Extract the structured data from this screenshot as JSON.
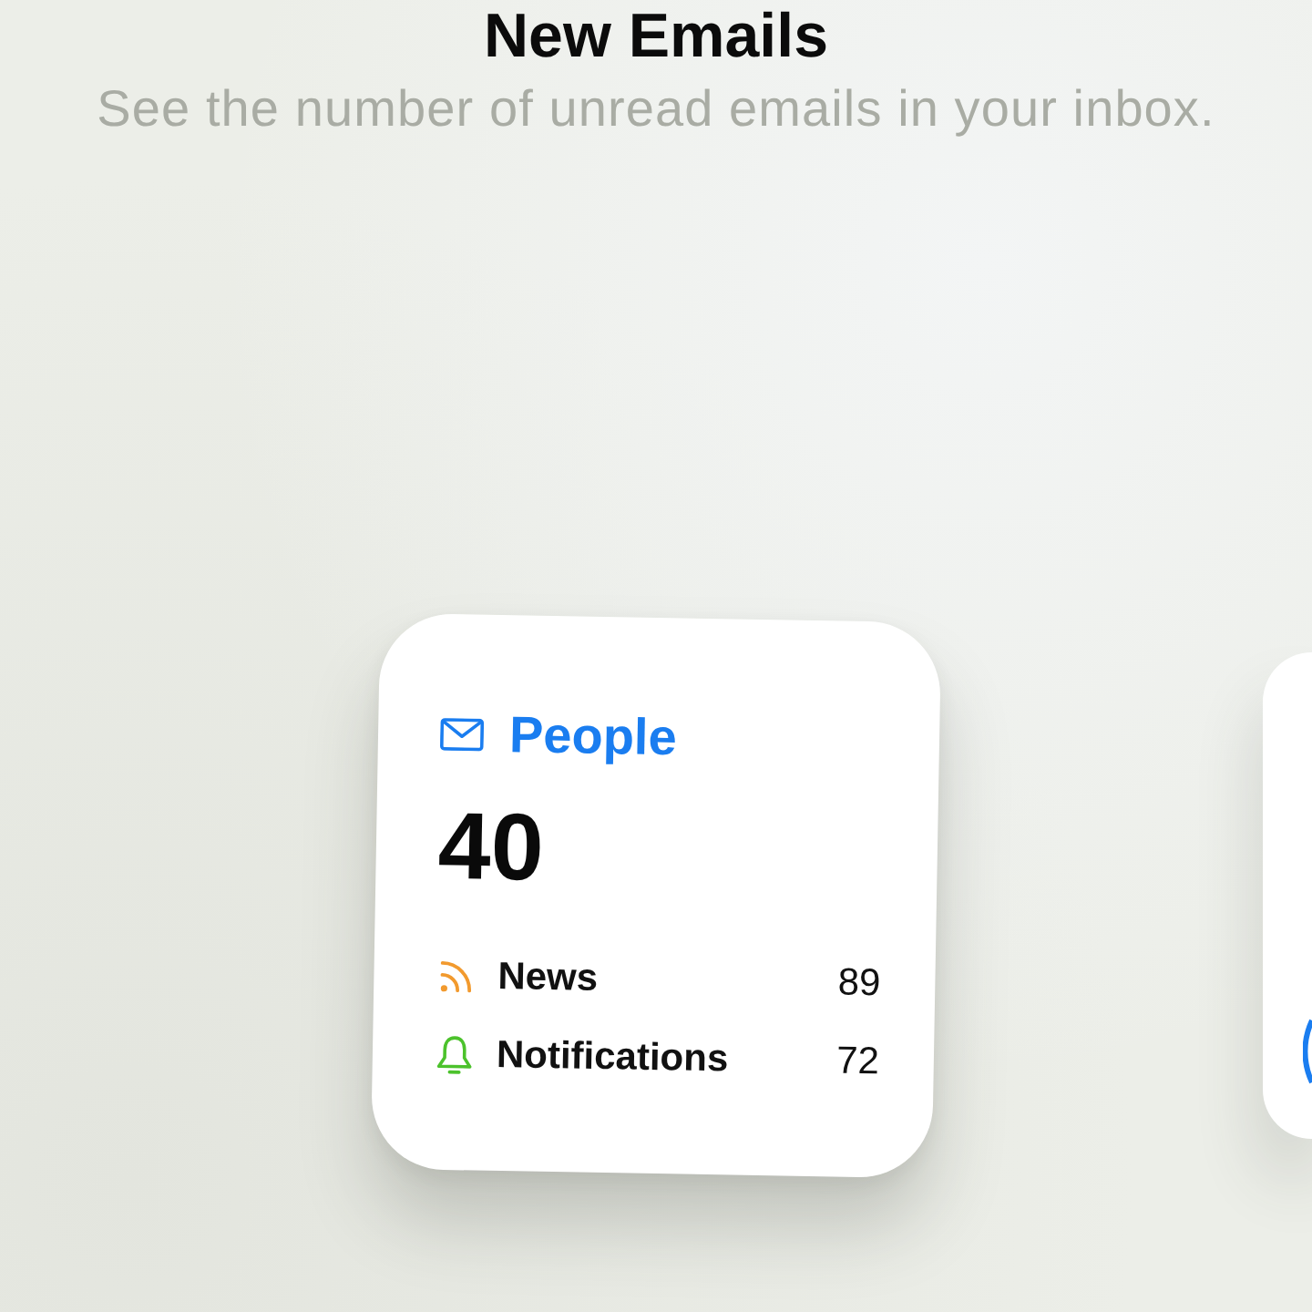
{
  "header": {
    "title": "New Emails",
    "subtitle": "See the number of unread emails in your inbox."
  },
  "widgets": [
    {
      "kind": "mail",
      "title": "People",
      "count": "40",
      "rows": [
        {
          "kind": "feed",
          "label": "News",
          "count": "89",
          "color": "#f29a2e"
        },
        {
          "kind": "alert",
          "label": "Notifications",
          "count": "72",
          "color": "#4cc22c"
        }
      ]
    },
    {
      "kind": "partial"
    }
  ]
}
